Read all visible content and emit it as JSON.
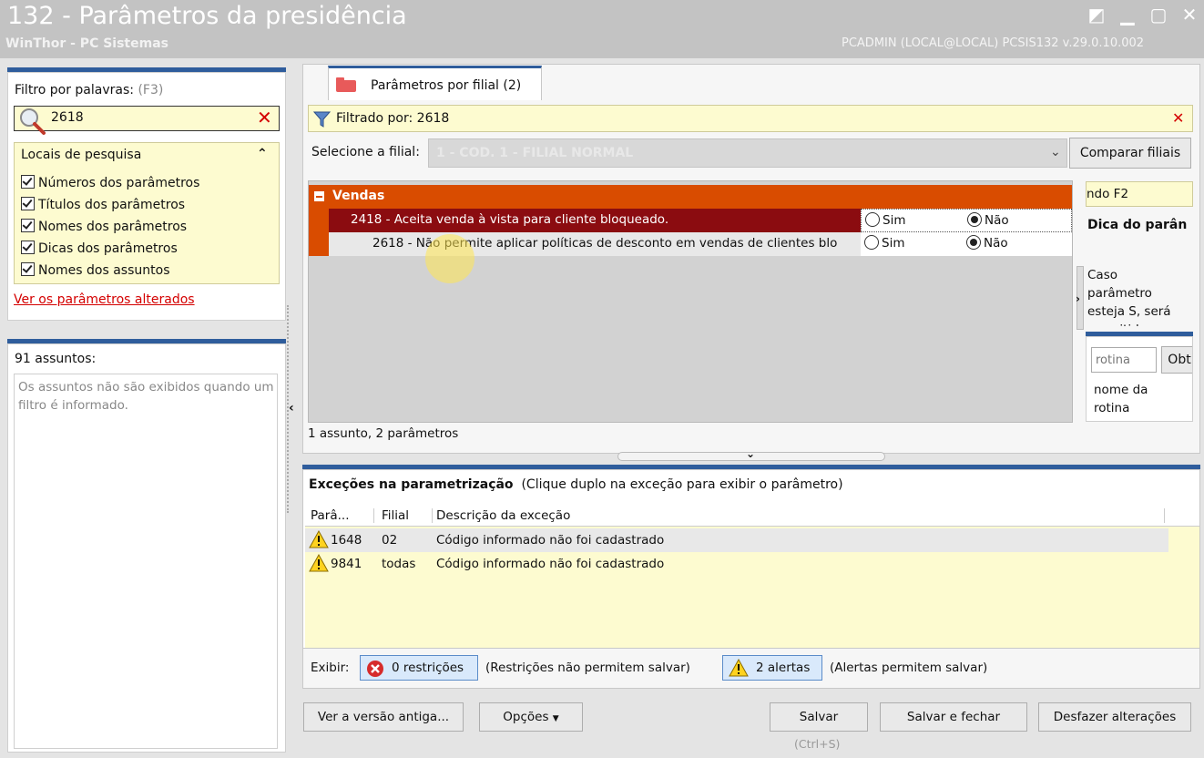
{
  "window": {
    "title": "132 - Parâmetros da presidência",
    "subtitle": "WinThor - PC Sistemas",
    "user_info": "PCADMIN (LOCAL@LOCAL)   PCSIS132  v.29.0.10.002"
  },
  "left": {
    "filter_label": "Filtro por palavras:",
    "filter_shortcut": "(F3)",
    "filter_value": "2618",
    "search_places_title": "Locais de pesquisa",
    "search_places": [
      "Números dos parâmetros",
      "Títulos dos parâmetros",
      "Nomes dos parâmetros",
      "Dicas dos parâmetros",
      "Nomes dos assuntos"
    ],
    "changed_link": "Ver os parâmetros alterados",
    "subjects_count": "91 assuntos:",
    "subjects_note": "Os assuntos não são exibidos quando um filtro é informado."
  },
  "tab": {
    "label": "Parâmetros por filial",
    "count": "(2)"
  },
  "filter_bar": {
    "text": "Filtrado por: 2618"
  },
  "branch": {
    "label": "Selecione a filial:",
    "selected": "1 - COD. 1 - FILIAL NORMAL",
    "compare_button": "Comparar filiais"
  },
  "grid": {
    "group": "Vendas",
    "rows": [
      {
        "text": "2418 - Aceita venda à vista para cliente bloqueado.",
        "yes": "Sim",
        "no": "Não",
        "selected": "no"
      },
      {
        "text": "2618 - Não permite aplicar políticas de desconto em vendas de clientes blo",
        "yes": "Sim",
        "no": "Não",
        "selected": "no"
      }
    ],
    "status": "1 assunto, 2 parâmetros"
  },
  "tip": {
    "f2_text": "ndo F2",
    "title": "Dica do parân",
    "body_lines": [
      "Caso",
      "parâmetro",
      "esteja S, será",
      "permitido"
    ],
    "routine_placeholder": "rotina",
    "obtain_button": "Obt",
    "routine_name_lines": [
      "nome da",
      "rotina"
    ]
  },
  "exceptions": {
    "title": "Exceções na parametrização",
    "hint": "(Clique duplo na exceção para exibir o parâmetro)",
    "columns": [
      "Parâ...",
      "Filial",
      "Descrição da exceção"
    ],
    "rows": [
      {
        "param": "1648",
        "filial": "02",
        "desc": "Código informado não foi cadastrado"
      },
      {
        "param": "9841",
        "filial": "todas",
        "desc": "Código informado não foi cadastrado"
      }
    ]
  },
  "show_bar": {
    "label": "Exibir:",
    "restrictions_button": "0 restrições",
    "restrictions_note": "(Restrições não permitem salvar)",
    "alerts_button": "2 alertas",
    "alerts_note": "(Alertas permitem salvar)"
  },
  "footer": {
    "old_version": "Ver a versão antiga...",
    "options": "Opções",
    "save": "Salvar",
    "save_shortcut": "(Ctrl+S)",
    "save_close": "Salvar e fechar",
    "undo": "Desfazer alterações"
  },
  "colors": {
    "group_header": "#d94c00",
    "selected_row": "#8b0c10",
    "yellow_bg": "#fdfbd0",
    "accent_blue": "#2f5d9c"
  }
}
